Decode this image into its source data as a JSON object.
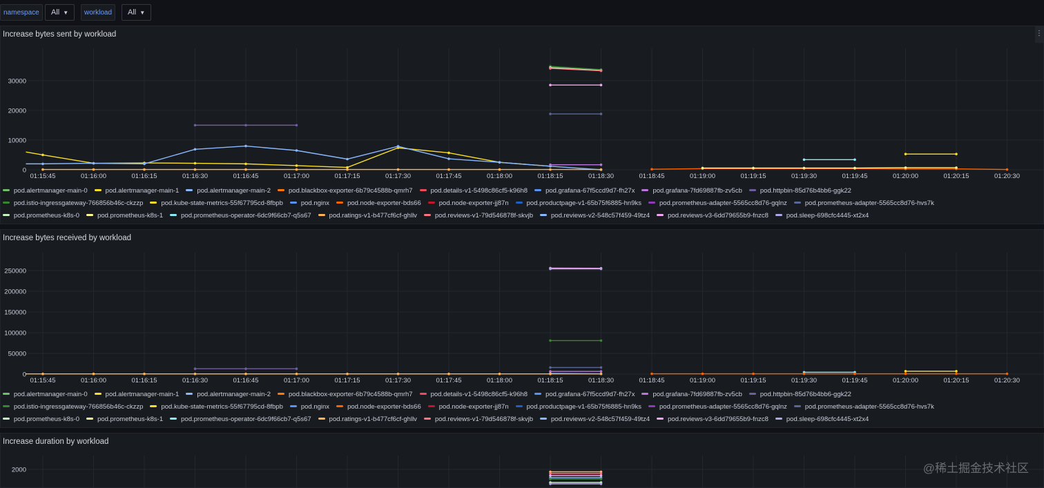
{
  "toolbar": {
    "namespace_label": "namespace",
    "namespace_value": "All",
    "workload_label": "workload",
    "workload_value": "All"
  },
  "panels": [
    {
      "title": "Increase bytes sent by workload"
    },
    {
      "title": "Increase bytes received by workload"
    },
    {
      "title": "Increase duration by workload"
    }
  ],
  "menu_glyph": "⋮",
  "watermark": "@稀土掘金技术社区",
  "legend": [
    {
      "name": "pod.alertmanager-main-0",
      "color": "#73bf69"
    },
    {
      "name": "pod.alertmanager-main-1",
      "color": "#fade2a"
    },
    {
      "name": "pod.alertmanager-main-2",
      "color": "#8ab8ff"
    },
    {
      "name": "pod.blackbox-exporter-6b79c4588b-qmrh7",
      "color": "#ff780a"
    },
    {
      "name": "pod.details-v1-5498c86cf5-k96h8",
      "color": "#f2495c"
    },
    {
      "name": "pod.grafana-67f5ccd9d7-fh27x",
      "color": "#5794f2"
    },
    {
      "name": "pod.grafana-7fd69887fb-zv5cb",
      "color": "#b877d9"
    },
    {
      "name": "pod.httpbin-85d76b4bb6-ggk22",
      "color": "#705da0"
    },
    {
      "name": "pod.istio-ingressgateway-766856b46c-ckzzp",
      "color": "#37872d"
    },
    {
      "name": "pod.kube-state-metrics-55f67795cd-8fbpb",
      "color": "#fade2a"
    },
    {
      "name": "pod.nginx",
      "color": "#5794f2"
    },
    {
      "name": "pod.node-exporter-bds66",
      "color": "#fa6400"
    },
    {
      "name": "pod.node-exporter-jj87n",
      "color": "#c4162a"
    },
    {
      "name": "pod.productpage-v1-65b75f6885-hn9ks",
      "color": "#1f60c4"
    },
    {
      "name": "pod.prometheus-adapter-5565cc8d76-gqlnz",
      "color": "#8f3bb8"
    },
    {
      "name": "pod.prometheus-adapter-5565cc8d76-hvs7k",
      "color": "#5a6695"
    },
    {
      "name": "pod.prometheus-k8s-0",
      "color": "#c8f2c2"
    },
    {
      "name": "pod.prometheus-k8s-1",
      "color": "#fff899"
    },
    {
      "name": "pod.prometheus-operator-6dc9f66cb7-q5s67",
      "color": "#8cecfa"
    },
    {
      "name": "pod.ratings-v1-b477cf6cf-ghllv",
      "color": "#ffb357"
    },
    {
      "name": "pod.reviews-v1-79d546878f-skvjb",
      "color": "#ff7383"
    },
    {
      "name": "pod.reviews-v2-548c57f459-49tz4",
      "color": "#8ab8ff"
    },
    {
      "name": "pod.reviews-v3-6dd79655b9-fnzc8",
      "color": "#f4a6f0"
    },
    {
      "name": "pod.sleep-698cfc4445-xt2x4",
      "color": "#b0a7e6"
    }
  ],
  "chart_data": [
    {
      "type": "line",
      "title": "Increase bytes sent by workload",
      "x_ticks": [
        "01:15:45",
        "01:16:00",
        "01:16:15",
        "01:16:30",
        "01:16:45",
        "01:17:00",
        "01:17:15",
        "01:17:30",
        "01:17:45",
        "01:18:00",
        "01:18:15",
        "01:18:30",
        "01:18:45",
        "01:19:00",
        "01:19:15",
        "01:19:30",
        "01:19:45",
        "01:20:00",
        "01:20:15",
        "01:20:30"
      ],
      "y_ticks": [
        "0",
        "10000",
        "20000",
        "30000"
      ],
      "ylim": [
        0,
        39000
      ],
      "grid": true,
      "legend_placement": "bottom",
      "series": [
        {
          "name": "pod.alertmanager-main-1",
          "color": "#fade2a",
          "points": [
            [
              "01:15:40",
              6000
            ],
            [
              "01:15:45",
              5000
            ],
            [
              "01:16:00",
              2200
            ],
            [
              "01:16:15",
              2300
            ],
            [
              "01:16:30",
              2200
            ],
            [
              "01:16:45",
              2000
            ],
            [
              "01:17:00",
              1400
            ],
            [
              "01:17:15",
              800
            ],
            [
              "01:17:30",
              7400
            ],
            [
              "01:17:45",
              5700
            ],
            [
              "01:18:00",
              2500
            ],
            [
              "01:18:15",
              1200
            ]
          ]
        },
        {
          "name": "pod.alertmanager-main-2",
          "color": "#8ab8ff",
          "points": [
            [
              "01:15:40",
              2000
            ],
            [
              "01:15:45",
              2000
            ],
            [
              "01:16:00",
              2200
            ],
            [
              "01:16:15",
              2000
            ],
            [
              "01:16:30",
              6900
            ],
            [
              "01:16:45",
              8000
            ],
            [
              "01:17:00",
              6500
            ],
            [
              "01:17:15",
              3600
            ],
            [
              "01:17:30",
              7900
            ],
            [
              "01:17:45",
              3700
            ],
            [
              "01:18:00",
              2500
            ],
            [
              "01:18:15",
              1200
            ],
            [
              "01:18:30",
              0
            ]
          ]
        },
        {
          "name": "pod.istio-ingressgateway-766856b46c-ckzzp",
          "color": "#37872d",
          "points": [
            [
              "01:18:15",
              34800
            ],
            [
              "01:18:30",
              33700
            ]
          ]
        },
        {
          "name": "pod.prometheus-k8s-0",
          "color": "#c8f2c2",
          "points": [
            [
              "01:18:15",
              34400
            ],
            [
              "01:18:30",
              33400
            ]
          ]
        },
        {
          "name": "pod.reviews-v1-79d546878f-skvjb",
          "color": "#ff7383",
          "points": [
            [
              "01:18:15",
              34100
            ],
            [
              "01:18:30",
              33300
            ]
          ]
        },
        {
          "name": "pod.reviews-v3-6dd79655b9-fnzc8",
          "color": "#f4a6f0",
          "points": [
            [
              "01:18:15",
              28500
            ],
            [
              "01:18:30",
              28500
            ]
          ]
        },
        {
          "name": "pod.prometheus-adapter-5565cc8d76-hvs7k",
          "color": "#5a6695",
          "points": [
            [
              "01:18:15",
              18800
            ],
            [
              "01:18:30",
              18800
            ]
          ]
        },
        {
          "name": "pod.httpbin-85d76b4bb6-ggk22",
          "color": "#705da0",
          "points": [
            [
              "01:16:30",
              15000
            ],
            [
              "01:16:45",
              15000
            ],
            [
              "01:17:00",
              15000
            ]
          ]
        },
        {
          "name": "pod.grafana-7fd69887fb-zv5cb",
          "color": "#b877d9",
          "points": [
            [
              "01:18:15",
              1700
            ],
            [
              "01:18:30",
              1700
            ]
          ]
        },
        {
          "name": "pod.prometheus-operator-6dc9f66cb7-q5s67",
          "color": "#8cecfa",
          "points": [
            [
              "01:19:30",
              3400
            ],
            [
              "01:19:45",
              3400
            ]
          ]
        },
        {
          "name": "pod.kube-state-metrics-55f67795cd-8fbpb",
          "color": "#fade2a",
          "points": [
            [
              "01:20:00",
              5300
            ],
            [
              "01:20:15",
              5300
            ]
          ]
        },
        {
          "name": "pod.node-exporter-bds66",
          "color": "#fa6400",
          "points": [
            [
              "01:18:45",
              200
            ],
            [
              "01:19:00",
              400
            ],
            [
              "01:19:15",
              400
            ],
            [
              "01:19:30",
              400
            ],
            [
              "01:19:45",
              400
            ],
            [
              "01:20:00",
              300
            ],
            [
              "01:20:15",
              300
            ],
            [
              "01:20:30",
              100
            ]
          ]
        },
        {
          "name": "pod.ratings-v1-b477cf6cf-ghllv",
          "color": "#ffb357",
          "points": [
            [
              "01:15:45",
              100
            ],
            [
              "01:16:00",
              100
            ],
            [
              "01:16:15",
              100
            ],
            [
              "01:16:30",
              100
            ],
            [
              "01:16:45",
              100
            ],
            [
              "01:17:00",
              100
            ],
            [
              "01:17:15",
              100
            ],
            [
              "01:17:30",
              100
            ],
            [
              "01:17:45",
              100
            ],
            [
              "01:18:00",
              100
            ],
            [
              "01:18:15",
              100
            ],
            [
              "01:18:30",
              100
            ]
          ]
        },
        {
          "name": "pod.prometheus-k8s-1",
          "color": "#fff899",
          "points": [
            [
              "01:19:00",
              600
            ],
            [
              "01:19:15",
              600
            ],
            [
              "01:19:30",
              600
            ],
            [
              "01:19:45",
              600
            ],
            [
              "01:20:00",
              700
            ],
            [
              "01:20:15",
              700
            ]
          ]
        }
      ]
    },
    {
      "type": "line",
      "title": "Increase bytes received by workload",
      "x_ticks": [
        "01:15:45",
        "01:16:00",
        "01:16:15",
        "01:16:30",
        "01:16:45",
        "01:17:00",
        "01:17:15",
        "01:17:30",
        "01:17:45",
        "01:18:00",
        "01:18:15",
        "01:18:30",
        "01:18:45",
        "01:19:00",
        "01:19:15",
        "01:19:30",
        "01:19:45",
        "01:20:00",
        "01:20:15",
        "01:20:30"
      ],
      "y_ticks": [
        "0",
        "50000",
        "100000",
        "150000",
        "200000",
        "250000"
      ],
      "ylim": [
        0,
        290000
      ],
      "grid": true,
      "legend_placement": "bottom",
      "series": [
        {
          "name": "pod.reviews-v3-6dd79655b9-fnzc8",
          "color": "#f4a6f0",
          "points": [
            [
              "01:18:15",
              256000
            ],
            [
              "01:18:30",
              255500
            ]
          ]
        },
        {
          "name": "pod.sleep-698cfc4445-xt2x4",
          "color": "#b0a7e6",
          "points": [
            [
              "01:18:15",
              254000
            ],
            [
              "01:18:30",
              254000
            ]
          ]
        },
        {
          "name": "pod.istio-ingressgateway-766856b46c-ckzzp",
          "color": "#37872d",
          "points": [
            [
              "01:18:15",
              81000
            ],
            [
              "01:18:30",
              81000
            ]
          ]
        },
        {
          "name": "pod.prometheus-adapter-5565cc8d76-hvs7k",
          "color": "#5a6695",
          "points": [
            [
              "01:18:15",
              16000
            ],
            [
              "01:18:30",
              16000
            ]
          ]
        },
        {
          "name": "pod.httpbin-85d76b4bb6-ggk22",
          "color": "#705da0",
          "points": [
            [
              "01:16:30",
              13000
            ],
            [
              "01:16:45",
              13000
            ],
            [
              "01:17:00",
              13000
            ]
          ]
        },
        {
          "name": "pod.grafana-7fd69887fb-zv5cb",
          "color": "#b877d9",
          "points": [
            [
              "01:18:15",
              6500
            ],
            [
              "01:18:30",
              6500
            ]
          ]
        },
        {
          "name": "pod.prometheus-operator-6dc9f66cb7-q5s67",
          "color": "#8cecfa",
          "points": [
            [
              "01:19:30",
              4500
            ],
            [
              "01:19:45",
              4500
            ]
          ]
        },
        {
          "name": "pod.kube-state-metrics-55f67795cd-8fbpb",
          "color": "#fade2a",
          "points": [
            [
              "01:20:00",
              7000
            ],
            [
              "01:20:15",
              7000
            ]
          ]
        },
        {
          "name": "pod.alertmanager-main-2",
          "color": "#8ab8ff",
          "points": [
            [
              "01:18:15",
              1500
            ],
            [
              "01:18:30",
              800
            ]
          ]
        },
        {
          "name": "pod.node-exporter-bds66",
          "color": "#fa6400",
          "points": [
            [
              "01:18:45",
              800
            ],
            [
              "01:19:00",
              800
            ],
            [
              "01:19:15",
              800
            ],
            [
              "01:19:30",
              800
            ],
            [
              "01:19:45",
              800
            ],
            [
              "01:20:00",
              800
            ],
            [
              "01:20:15",
              800
            ],
            [
              "01:20:30",
              800
            ]
          ]
        },
        {
          "name": "pod.ratings-v1-b477cf6cf-ghllv",
          "color": "#ffb357",
          "points": [
            [
              "01:15:40",
              500
            ],
            [
              "01:15:45",
              500
            ],
            [
              "01:16:00",
              500
            ],
            [
              "01:16:15",
              500
            ],
            [
              "01:16:30",
              500
            ],
            [
              "01:16:45",
              500
            ],
            [
              "01:17:00",
              500
            ],
            [
              "01:17:15",
              500
            ],
            [
              "01:17:30",
              500
            ],
            [
              "01:17:45",
              500
            ],
            [
              "01:18:00",
              500
            ],
            [
              "01:18:15",
              500
            ],
            [
              "01:18:30",
              500
            ]
          ]
        }
      ]
    },
    {
      "type": "line",
      "title": "Increase duration by workload",
      "y_ticks": [
        "2000"
      ],
      "grid": true,
      "series": [
        {
          "name": "pod.ratings-v1-b477cf6cf-ghllv",
          "color": "#ffb357",
          "points": [
            [
              "01:18:15",
              1930
            ],
            [
              "01:18:30",
              1930
            ]
          ]
        },
        {
          "name": "pod.reviews-v1-79d546878f-skvjb",
          "color": "#ff7383",
          "points": [
            [
              "01:18:15",
              1880
            ],
            [
              "01:18:30",
              1880
            ]
          ]
        },
        {
          "name": "pod.reviews-v3-6dd79655b9-fnzc8",
          "color": "#f4a6f0",
          "points": [
            [
              "01:18:15",
              1820
            ],
            [
              "01:18:30",
              1820
            ]
          ]
        },
        {
          "name": "pod.alertmanager-main-2",
          "color": "#8ab8ff",
          "points": [
            [
              "01:18:15",
              1760
            ],
            [
              "01:18:30",
              1760
            ]
          ]
        },
        {
          "name": "pod.istio-ingressgateway-766856b46c-ckzzp",
          "color": "#37872d",
          "points": [
            [
              "01:18:15",
              1720
            ],
            [
              "01:18:30",
              1720
            ]
          ]
        },
        {
          "name": "pod.prometheus-k8s-0",
          "color": "#c8f2c2",
          "points": [
            [
              "01:18:15",
              1620
            ],
            [
              "01:18:30",
              1620
            ]
          ]
        },
        {
          "name": "pod.sleep-698cfc4445-xt2x4",
          "color": "#b0a7e6",
          "points": [
            [
              "01:18:15",
              1580
            ],
            [
              "01:18:30",
              1580
            ]
          ]
        }
      ]
    }
  ]
}
